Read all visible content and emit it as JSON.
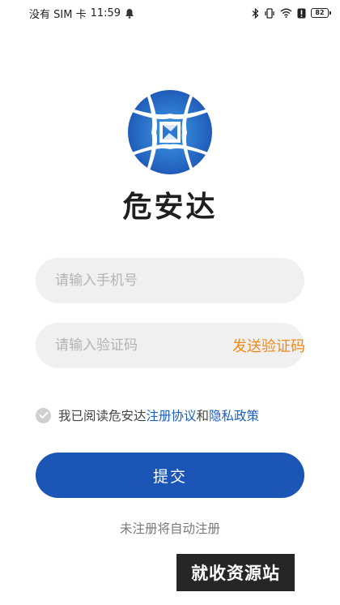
{
  "status_bar": {
    "carrier": "没有 SIM 卡",
    "time": "11:59",
    "battery": "82",
    "icons": [
      "notification-bell-icon",
      "bluetooth-icon",
      "vibrate-icon",
      "wifi-icon",
      "alert-icon",
      "battery-icon"
    ]
  },
  "brand": {
    "name": "危安达",
    "logo_colors": [
      "#1a4fb0",
      "#2f8ee0"
    ]
  },
  "form": {
    "phone_placeholder": "请输入手机号",
    "phone_value": "",
    "code_placeholder": "请输入验证码",
    "code_value": "",
    "send_code_label": "发送验证码"
  },
  "agreement": {
    "checked": true,
    "prefix": "我已阅读危安达",
    "terms_link": "注册协议",
    "conjunction": "和",
    "privacy_link": "隐私政策"
  },
  "submit_label": "提交",
  "auto_register_hint": "未注册将自动注册",
  "watermark": "就收资源站",
  "colors": {
    "primary": "#1b55b6",
    "accent": "#f08a18",
    "link": "#1b5fbf"
  }
}
